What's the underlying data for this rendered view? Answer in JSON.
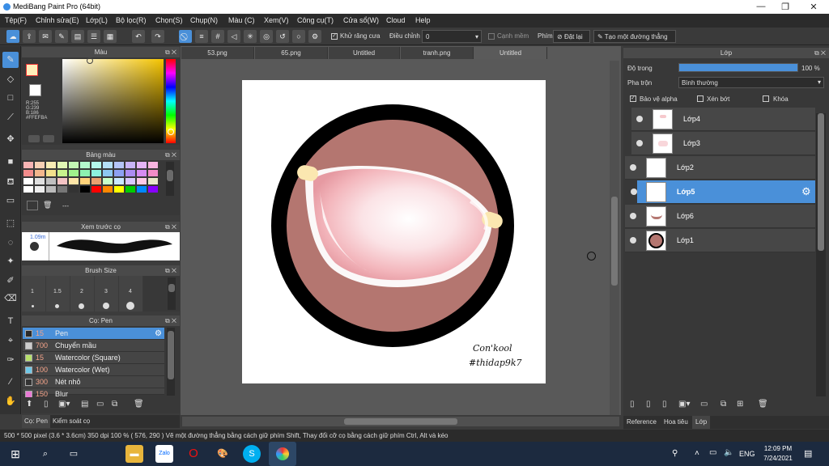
{
  "window": {
    "title": "MediBang Paint Pro (64bit)",
    "min": "—",
    "max": "❐",
    "close": "✕"
  },
  "menu": [
    "Tệp(F)",
    "Chỉnh sửa(E)",
    "Lớp(L)",
    "Bộ lọc(R)",
    "Chọn(S)",
    "Chụp(N)",
    "Màu (C)",
    "Xem(V)",
    "Công cụ(T)",
    "Cửa sổ(W)",
    "Cloud",
    "Help"
  ],
  "toolbar": {
    "antialias_label": "Khử răng cưa",
    "adjust_label": "Điều chỉnh",
    "adjust_value": "0",
    "smooth_edge_label": "Cạnh mềm",
    "key_label": "Phím",
    "reset_label": "Đặt lại",
    "line_label": "Tạo một đường thẳng"
  },
  "color_panel": {
    "title": "Màu",
    "r": "R:255",
    "g": "G:239",
    "b": "B:186",
    "hex": "#FFEFBA"
  },
  "palette_panel": {
    "title": "Bảng màu",
    "dashes": "---"
  },
  "preview_panel": {
    "title": "Xem trước cọ",
    "size": "1.09m"
  },
  "brush_size_panel": {
    "title": "Brush Size",
    "sizes": [
      "1",
      "1.5",
      "2",
      "3",
      "4"
    ]
  },
  "brush_panel": {
    "title": "Cọ: Pen",
    "items": [
      {
        "size": "15",
        "name": "Pen",
        "color": "#2a2a2a"
      },
      {
        "size": "700",
        "name": "Chuyển mầu",
        "color": "#cccccc"
      },
      {
        "size": "15",
        "name": "Watercolor (Square)",
        "color": "#b7e06a"
      },
      {
        "size": "100",
        "name": "Watercolor (Wet)",
        "color": "#6fc8e8"
      },
      {
        "size": "300",
        "name": "Nét nhỏ",
        "color": "#333333"
      },
      {
        "size": "150",
        "name": "Blur",
        "color": "#e87ad4"
      }
    ]
  },
  "left_bottom_tabs": [
    "Cọ: Pen",
    "Kiểm soát cọ"
  ],
  "doc_tabs": [
    "53.png",
    "65.png",
    "Untitled",
    "tranh.png",
    "Untitled"
  ],
  "canvas": {
    "signature_line1": "Con'kool",
    "signature_line2": "#thidap9k7"
  },
  "layer_panel": {
    "title": "Lớp",
    "opacity_label": "Độ trong",
    "opacity_value": "100 %",
    "opacity_fraction": 1.0,
    "blend_label": "Pha trộn",
    "blend_value": "Bình thường",
    "protect_alpha": "Bảo vệ alpha",
    "clipping": "Xén bớt",
    "lock": "Khóa",
    "layers": [
      "Lớp4",
      "Lớp3",
      "Lớp2",
      "Lớp5",
      "Lớp6",
      "Lớp1"
    ]
  },
  "right_bottom_tabs": [
    "Reference",
    "Hoa tiêu",
    "Lớp"
  ],
  "status": "500 * 500 pixel   (3.6 * 3.6cm)   350 dpi   100 %   ( 576, 290 )   Vẽ một đường thẳng bằng cách giữ phím Shift, Thay đổi cỡ cọ bằng cách giữ phím Ctrl, Alt và kéo",
  "taskbar": {
    "lang": "ENG",
    "time": "12:09 PM",
    "date": "7/24/2021"
  }
}
